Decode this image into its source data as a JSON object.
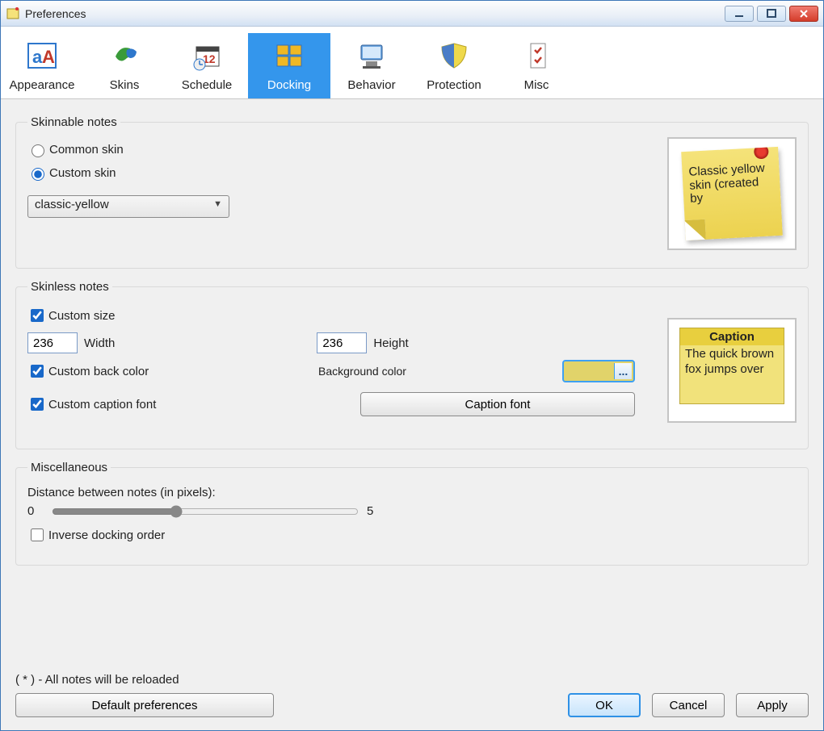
{
  "window": {
    "title": "Preferences"
  },
  "tabs": [
    {
      "label": "Appearance"
    },
    {
      "label": "Skins"
    },
    {
      "label": "Schedule"
    },
    {
      "label": "Docking"
    },
    {
      "label": "Behavior"
    },
    {
      "label": "Protection"
    },
    {
      "label": "Misc"
    }
  ],
  "skinnable": {
    "legend": "Skinnable notes",
    "radio_common": "Common skin",
    "radio_custom": "Custom skin",
    "selected_radio": "custom",
    "combo_value": "classic-yellow",
    "preview_text": "Classic yellow skin (created by"
  },
  "skinless": {
    "legend": "Skinless notes",
    "cb_custom_size": "Custom size",
    "width_value": "236",
    "width_label": "Width",
    "height_value": "236",
    "height_label": "Height",
    "cb_custom_back": "Custom back color",
    "bg_label": "Background color",
    "bg_color": "#e1d36a",
    "cb_custom_caption": "Custom caption font",
    "caption_btn": "Caption font",
    "preview_caption": "Caption",
    "preview_body": "The quick brown fox jumps over"
  },
  "misc": {
    "legend": "Miscellaneous",
    "dist_label": "Distance between notes (in pixels):",
    "slider_min": "0",
    "slider_max": "5",
    "slider_value": "2",
    "cb_inverse": "Inverse docking order"
  },
  "footer": {
    "note": "( * ) - All notes will be reloaded",
    "default_btn": "Default preferences",
    "ok": "OK",
    "cancel": "Cancel",
    "apply": "Apply"
  }
}
